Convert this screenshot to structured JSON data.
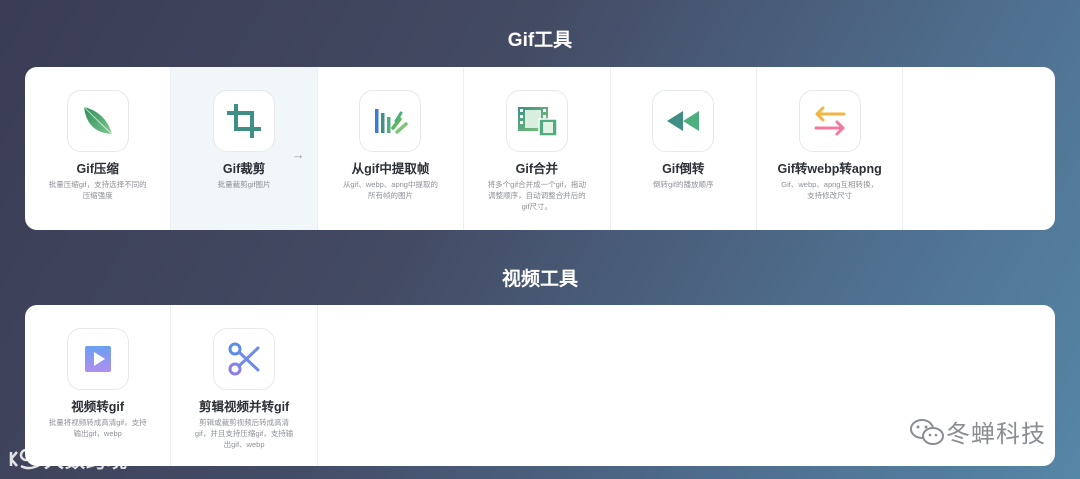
{
  "gif_section": {
    "title": "Gif工具",
    "tools": [
      {
        "title": "Gif压缩",
        "desc": "批量压缩gif，支持选择不同的压缩强度",
        "icon": "leaf-icon"
      },
      {
        "title": "Gif裁剪",
        "desc": "批量裁剪gif图片",
        "icon": "crop-icon",
        "active": true
      },
      {
        "title": "从gif中提取帧",
        "desc": "从gif、webp、apng中提取的所有帧的图片",
        "icon": "frames-extract-icon"
      },
      {
        "title": "Gif合并",
        "desc": "将多个gif合并成一个gif，拖动调整顺序，自动调整合并后的gif尺寸。",
        "icon": "film-icon"
      },
      {
        "title": "Gif倒转",
        "desc": "倒转gif的播放顺序",
        "icon": "rewind-icon"
      },
      {
        "title": "Gif转webp转apng",
        "desc": "Gif、webp、apng互相转换，支持修改尺寸",
        "icon": "swap-arrows-icon"
      }
    ],
    "arrow_icon": "→"
  },
  "video_section": {
    "title": "视频工具",
    "tools": [
      {
        "title": "视频转gif",
        "desc": "批量将视频转成高清gif，支持输出gif，webp",
        "icon": "play-icon"
      },
      {
        "title": "剪辑视频并转gif",
        "desc": "剪辑或裁剪视频后转成高清gif，并且支持压缩gif，支持输出gif、webp",
        "icon": "scissors-icon"
      }
    ]
  },
  "watermarks": {
    "left": "大数跨境",
    "right": "冬蝉科技"
  },
  "colors": {
    "background_start": "#3a3d54",
    "background_end": "#5686a6",
    "active_card": "#f1f6f9",
    "icon_green": "#4caf7d",
    "icon_teal": "#3f8f86"
  }
}
